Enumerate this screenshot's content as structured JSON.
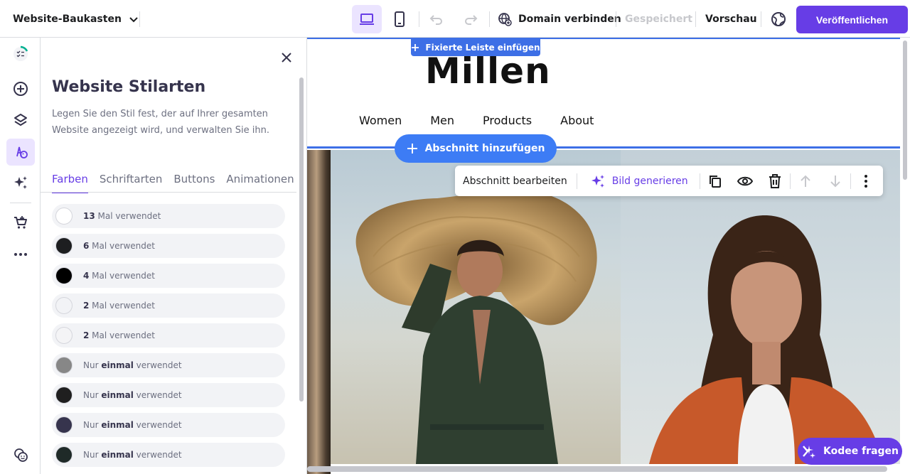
{
  "topbar": {
    "brand": "Website-Baukasten",
    "connect_domain": "Domain verbinden",
    "saved": "Gespeichert",
    "preview": "Vorschau",
    "publish": "Veröffentlichen"
  },
  "panel": {
    "title": "Website Stilarten",
    "description": "Legen Sie den Stil fest, der auf Ihrer gesamten Website angezeigt wird, und verwalten Sie ihn.",
    "tabs": [
      "Farben",
      "Schriftarten",
      "Buttons",
      "Animationen"
    ],
    "colors": [
      {
        "count": "13",
        "suffix": " Mal verwendet",
        "prefix": "",
        "color": "#ffffff"
      },
      {
        "count": "6",
        "suffix": " Mal verwendet",
        "prefix": "",
        "color": "#1d1e20"
      },
      {
        "count": "4",
        "suffix": " Mal verwendet",
        "prefix": "",
        "color": "#000000"
      },
      {
        "count": "2",
        "suffix": " Mal verwendet",
        "prefix": "",
        "color": "#f2f3f6"
      },
      {
        "count": "2",
        "suffix": " Mal verwendet",
        "prefix": "",
        "color": "#f4f4f6"
      },
      {
        "count": "einmal",
        "suffix": " verwendet",
        "prefix": "Nur ",
        "color": "#878787"
      },
      {
        "count": "einmal",
        "suffix": " verwendet",
        "prefix": "Nur ",
        "color": "#1f1f1f"
      },
      {
        "count": "einmal",
        "suffix": " verwendet",
        "prefix": "Nur ",
        "color": "#36344d"
      },
      {
        "count": "einmal",
        "suffix": " verwendet",
        "prefix": "Nur ",
        "color": "#1f2a28"
      }
    ]
  },
  "canvas": {
    "logo": "Millen",
    "nav": [
      "Women",
      "Men",
      "Products",
      "About"
    ],
    "fixed_bar_button": "Fixierte Leiste einfügen",
    "add_section_button": "Abschnitt hinzufügen",
    "toolbar": {
      "edit_section": "Abschnitt bearbeiten",
      "generate_image": "Bild generieren"
    }
  },
  "assistant": {
    "label": "Kodee fragen"
  },
  "colors": {
    "accent": "#673de6",
    "accent_light": "#ebe4ff",
    "edit_blue": "#3d6fe6"
  }
}
